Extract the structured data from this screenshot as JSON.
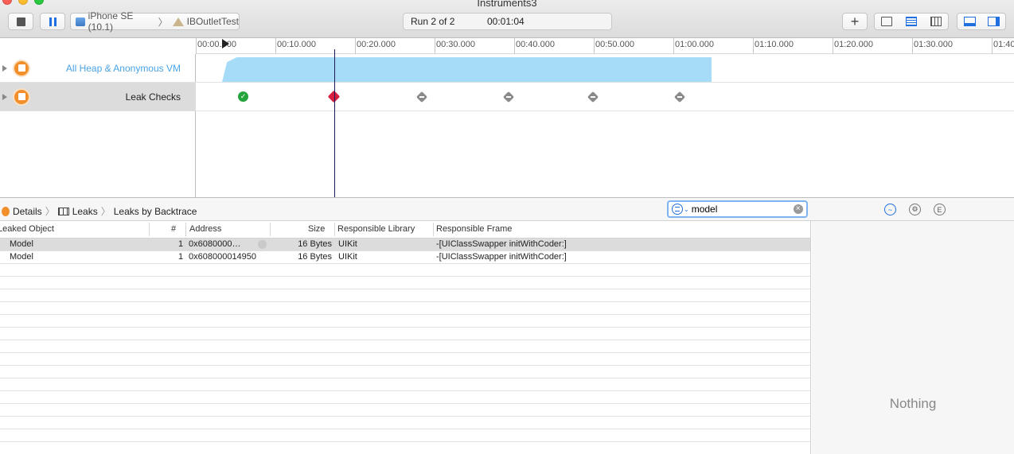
{
  "window": {
    "title": "Instruments3"
  },
  "toolbar": {
    "device": "iPhone SE (10.1)",
    "target": "IBOutletTest",
    "run_label": "Run 2 of 2",
    "elapsed": "00:01:04"
  },
  "ruler": {
    "ticks": [
      "00:00.000",
      "00:10.000",
      "00:20.000",
      "00:30.000",
      "00:40.000",
      "00:50.000",
      "01:00.000",
      "01:10.000",
      "01:20.000",
      "01:30.000",
      "01:40"
    ]
  },
  "tracks": [
    {
      "label": "All Heap & Anonymous VM"
    },
    {
      "label": "Leak Checks"
    }
  ],
  "leak_checks": [
    {
      "status": "ok"
    },
    {
      "status": "leak"
    },
    {
      "status": "none"
    },
    {
      "status": "none"
    },
    {
      "status": "none"
    },
    {
      "status": "none"
    }
  ],
  "jumpbar": {
    "details": "Details",
    "leaks": "Leaks",
    "view": "Leaks by Backtrace"
  },
  "filter": {
    "value": "model"
  },
  "table": {
    "columns": {
      "object": "Leaked Object",
      "count": "#",
      "address": "Address",
      "size": "Size",
      "library": "Responsible Library",
      "frame": "Responsible Frame"
    },
    "rows": [
      {
        "object": "Model",
        "count": "1",
        "address": "0x6080000…",
        "size": "16 Bytes",
        "library": "UIKit",
        "frame": "-[UIClassSwapper initWithCoder:]"
      },
      {
        "object": "Model",
        "count": "1",
        "address": "0x608000014950",
        "size": "16 Bytes",
        "library": "UIKit",
        "frame": "-[UIClassSwapper initWithCoder:]"
      }
    ]
  },
  "inspector": {
    "empty": "Nothing"
  }
}
